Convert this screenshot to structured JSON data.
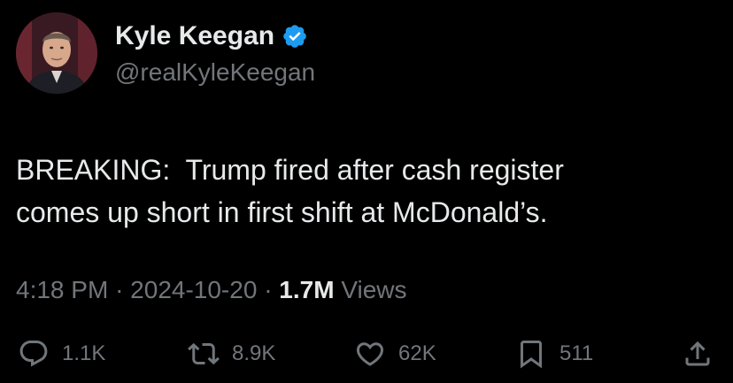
{
  "author": {
    "display_name": "Kyle Keegan",
    "handle": "@realKyleKeegan",
    "verified": true,
    "verified_color": "#1d9bf0"
  },
  "tweet": {
    "lines": [
      "BREAKING:  Trump fired after cash register",
      "comes up short in first shift at McDonald’s."
    ]
  },
  "meta": {
    "time": "4:18 PM",
    "separator": "·",
    "date": "2024-10-20",
    "views_count": "1.7M",
    "views_label": "Views"
  },
  "actions": {
    "reply": {
      "icon": "reply-icon",
      "count": "1.1K"
    },
    "repost": {
      "icon": "repost-icon",
      "count": "8.9K"
    },
    "like": {
      "icon": "heart-icon",
      "count": "62K"
    },
    "bookmark": {
      "icon": "bookmark-icon",
      "count": "511"
    },
    "share": {
      "icon": "share-icon"
    }
  },
  "colors": {
    "background": "#000000",
    "primary_text": "#e7e9ea",
    "secondary_text": "#71767b"
  }
}
